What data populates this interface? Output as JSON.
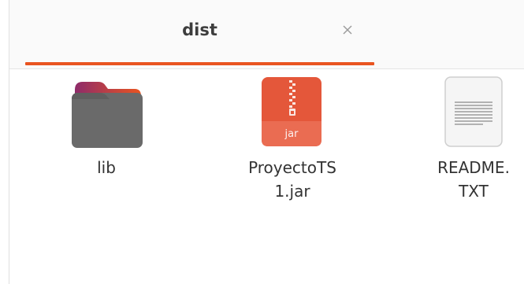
{
  "window": {
    "tab": {
      "title": "dist",
      "close_icon": "close-icon",
      "accent_color": "#e95420"
    }
  },
  "files": [
    {
      "name": "lib",
      "type": "folder",
      "icon": "folder-icon"
    },
    {
      "name": "ProyectoTS\n1.jar",
      "type": "jar",
      "icon": "jar-archive-icon",
      "icon_label": "jar"
    },
    {
      "name": "README.\nTXT",
      "type": "text",
      "icon": "text-file-icon"
    }
  ],
  "colors": {
    "folder_body": "#6b6b6b",
    "folder_tab_gradient": [
      "#8e2b6a",
      "#e95420"
    ],
    "jar_fill": "#e4573a",
    "text_file": "#f4f4f4"
  }
}
